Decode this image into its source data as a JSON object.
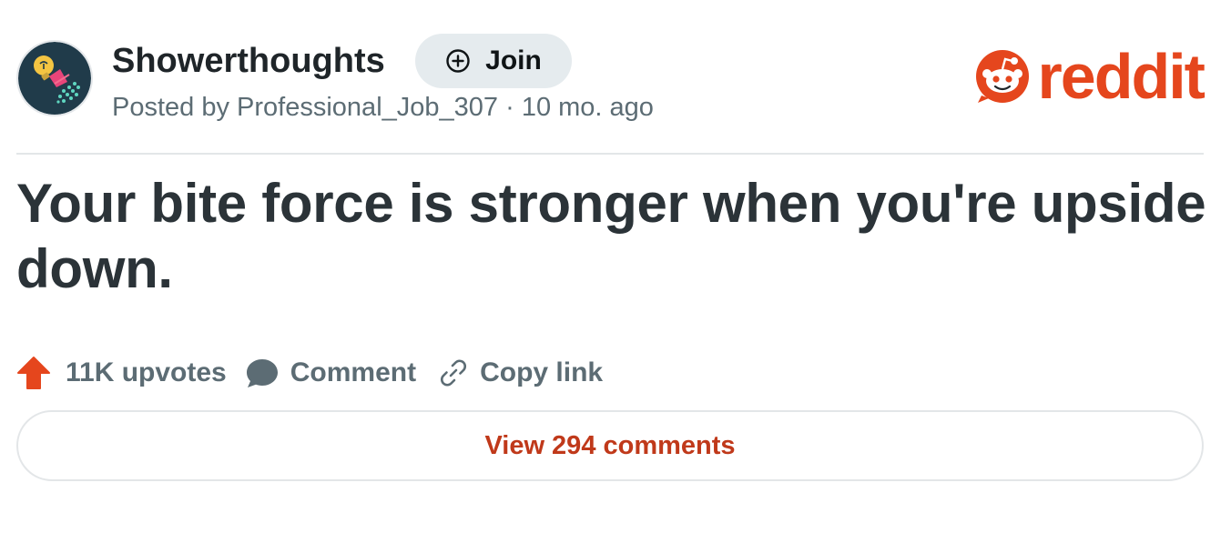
{
  "community": {
    "name": "Showerthoughts",
    "join_label": "Join",
    "posted_by_prefix": "Posted by",
    "author": "Professional_Job_307",
    "separator": "·",
    "age": "10 mo. ago"
  },
  "brand": {
    "wordmark": "reddit",
    "color": "#e5461d"
  },
  "post": {
    "title": "Your bite force is stronger when you're upside down."
  },
  "actions": {
    "upvotes_label": "11K upvotes",
    "comment_label": "Comment",
    "copy_link_label": "Copy link"
  },
  "footer": {
    "view_comments_label": "View 294 comments"
  },
  "colors": {
    "upvote": "#e5461d",
    "view_comments_text": "#c0391a",
    "avatar_bg": "#203b4a"
  }
}
